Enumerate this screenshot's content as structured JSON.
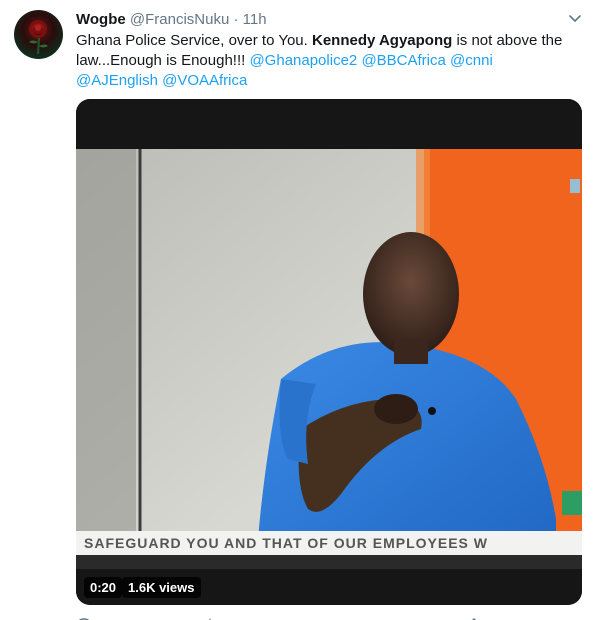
{
  "tweet": {
    "name": "Wogbe",
    "handle": "@FrancisNuku",
    "separator": "·",
    "time": "11h",
    "text_parts": [
      {
        "text": "Ghana Police Service, over to You. ",
        "style": "normal"
      },
      {
        "text": "Kennedy Agyapong",
        "style": "bold"
      },
      {
        "text": " is not above the law...Enough is Enough!!! ",
        "style": "normal"
      },
      {
        "text": "@Ghanapolice2",
        "style": "mention"
      },
      {
        "text": " ",
        "style": "normal"
      },
      {
        "text": "@BBCAfrica",
        "style": "mention"
      },
      {
        "text": " ",
        "style": "normal"
      },
      {
        "text": "@cnni",
        "style": "mention"
      },
      {
        "text": " ",
        "style": "normal"
      },
      {
        "text": "@AJEnglish",
        "style": "mention"
      },
      {
        "text": " ",
        "style": "normal"
      },
      {
        "text": "@VOAAfrica",
        "style": "mention"
      }
    ],
    "video": {
      "duration": "0:20",
      "views": "1.6K views",
      "ticker_text": "SAFEGUARD YOU AND THAT OF OUR EMPLOYEES W"
    },
    "icons": {
      "menu": "chevron-down-icon",
      "avatar": "rose-avatar"
    }
  },
  "colors": {
    "text": "#14171a",
    "secondary": "#657786",
    "link": "#1da1f2",
    "shirt": "#2f7fd8",
    "backdrop_orange": "#f0641e"
  }
}
